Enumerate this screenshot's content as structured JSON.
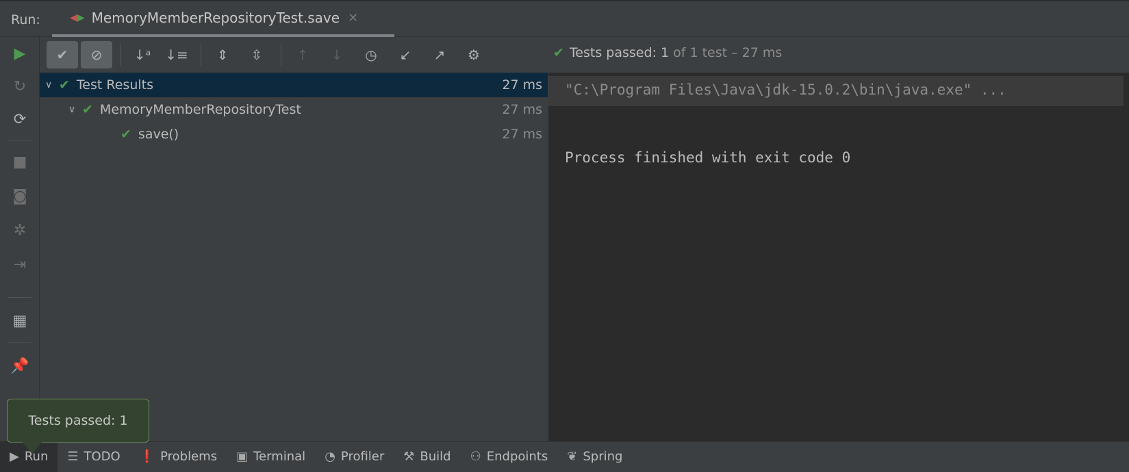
{
  "header": {
    "run_label": "Run:",
    "tab_title": "MemoryMemberRepositoryTest.save"
  },
  "toolbar": {
    "status_prefix": "Tests passed: ",
    "status_count": "1",
    "status_suffix": " of 1 test – 27 ms"
  },
  "tree": [
    {
      "label": "Test Results",
      "time": "27 ms"
    },
    {
      "label": "MemoryMemberRepositoryTest",
      "time": "27 ms"
    },
    {
      "label": "save()",
      "time": "27 ms"
    }
  ],
  "console": {
    "command": "\"C:\\Program Files\\Java\\jdk-15.0.2\\bin\\java.exe\" ...",
    "exit": "Process finished with exit code 0"
  },
  "tooltip": "Tests passed: 1",
  "bottom": [
    "Run",
    "TODO",
    "Problems",
    "Terminal",
    "Profiler",
    "Build",
    "Endpoints",
    "Spring"
  ],
  "colors": {
    "pass": "#4e9a4e",
    "selection": "#0d293e"
  }
}
